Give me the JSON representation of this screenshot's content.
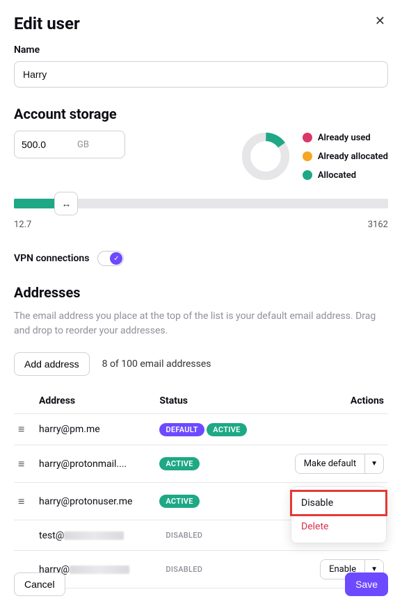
{
  "header": {
    "title": "Edit user"
  },
  "name": {
    "label": "Name",
    "value": "Harry"
  },
  "storage": {
    "title": "Account storage",
    "value": "500.0",
    "unit": "GB",
    "slider_min": "12.7",
    "slider_max": "3162",
    "legend": {
      "used": "Already used",
      "allocated_other": "Already allocated",
      "allocated": "Allocated"
    },
    "colors": {
      "used": "#d93868",
      "allocated_other": "#f5a623",
      "allocated": "#1ea885",
      "track": "#e6e6e9"
    }
  },
  "vpn": {
    "label": "VPN connections",
    "enabled": true
  },
  "addresses": {
    "title": "Addresses",
    "help": "The email address you place at the top of the list is your default email address. Drag and drop to reorder your addresses.",
    "add_button": "Add address",
    "count_text": "8 of 100 email addresses",
    "columns": {
      "address": "Address",
      "status": "Status",
      "actions": "Actions"
    },
    "badges": {
      "default": "DEFAULT",
      "active": "ACTIVE",
      "disabled": "DISABLED"
    },
    "action_labels": {
      "make_default": "Make default",
      "enable": "Enable",
      "disable": "Disable",
      "delete": "Delete"
    },
    "rows": [
      {
        "address": "harry@pm.me",
        "status": [
          "default",
          "active"
        ],
        "draggable": true,
        "action": null
      },
      {
        "address": "harry@protonmail....",
        "status": [
          "active"
        ],
        "draggable": true,
        "action": "make_default"
      },
      {
        "address": "harry@protonuser.me",
        "status": [
          "active"
        ],
        "draggable": true,
        "action": "make_default_open"
      },
      {
        "address_prefix": "test@",
        "redacted": true,
        "status": [
          "disabled"
        ],
        "draggable": false,
        "action": "covered"
      },
      {
        "address_prefix": "harry@",
        "redacted": true,
        "status": [
          "disabled"
        ],
        "draggable": false,
        "action": "enable"
      }
    ]
  },
  "footer": {
    "cancel": "Cancel",
    "save": "Save"
  }
}
